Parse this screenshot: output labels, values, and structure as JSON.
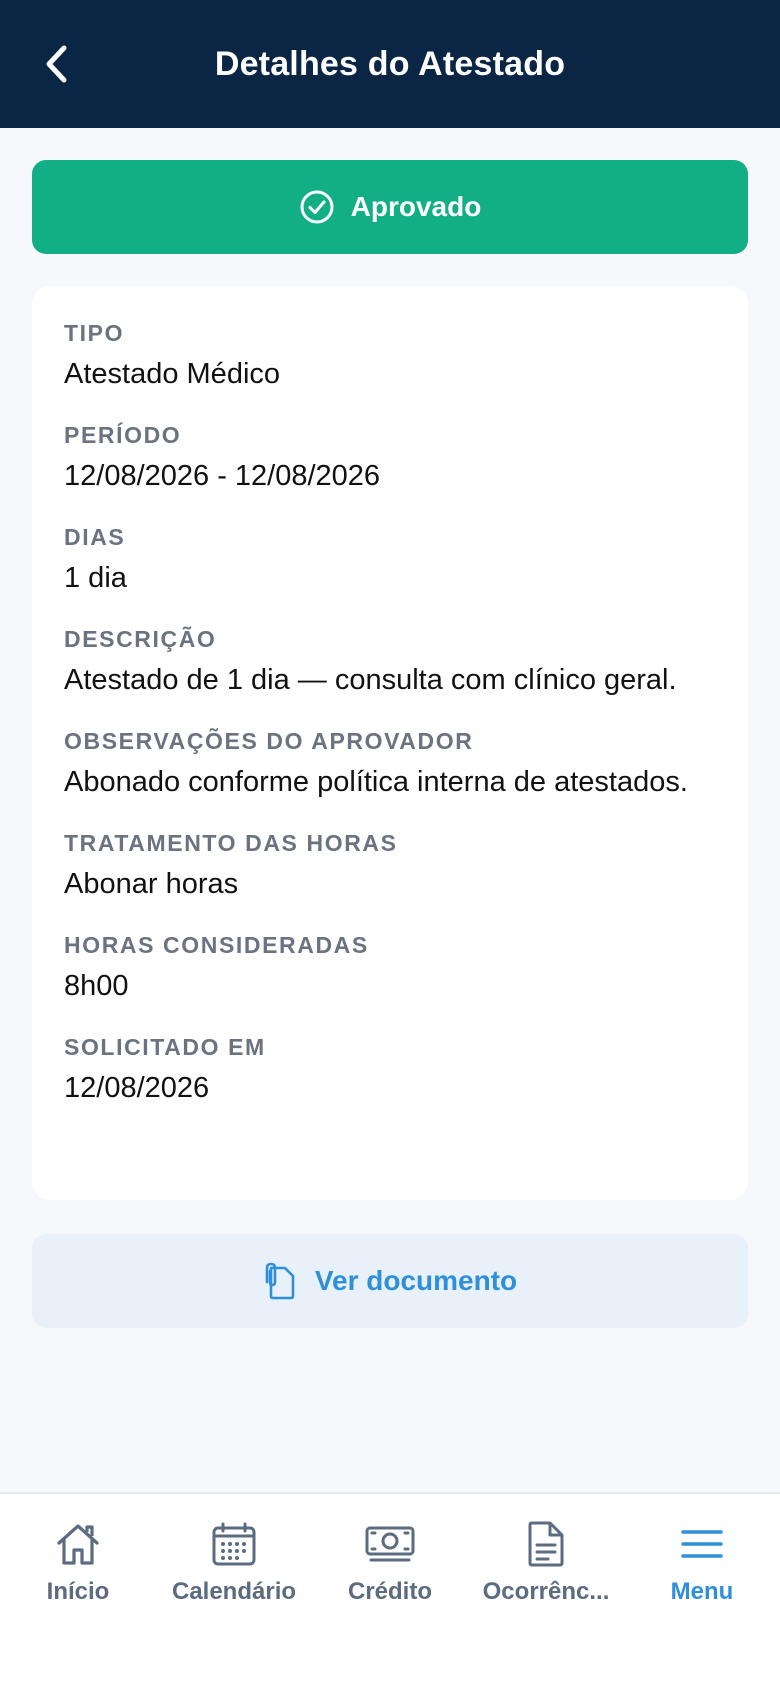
{
  "header": {
    "title": "Detalhes do Atestado",
    "back_icon": "chevron-left-icon"
  },
  "status": {
    "label": "Aprovado",
    "icon": "check-circle-icon",
    "color": "#12ae86"
  },
  "details": {
    "fields": [
      {
        "label": "TIPO",
        "value": "Atestado Médico"
      },
      {
        "label": "PERÍODO",
        "value": "12/08/2026 - 12/08/2026"
      },
      {
        "label": "DIAS",
        "value": "1 dia"
      },
      {
        "label": "DESCRIÇÃO",
        "value": "Atestado de 1 dia — consulta com clínico geral."
      },
      {
        "label": "OBSERVAÇÕES DO APROVADOR",
        "value": "Abonado conforme política interna de atestados."
      },
      {
        "label": "TRATAMENTO DAS HORAS",
        "value": "Abonar horas"
      },
      {
        "label": "HORAS CONSIDERADAS",
        "value": "8h00"
      },
      {
        "label": "SOLICITADO EM",
        "value": "12/08/2026"
      }
    ]
  },
  "document_button": {
    "label": "Ver documento",
    "icon": "paperclip-document-icon"
  },
  "tabbar": {
    "items": [
      {
        "label": "Início",
        "icon": "home-icon"
      },
      {
        "label": "Calendário",
        "icon": "calendar-icon"
      },
      {
        "label": "Crédito",
        "icon": "money-icon"
      },
      {
        "label": "Ocorrênc...",
        "icon": "document-icon"
      },
      {
        "label": "Menu",
        "icon": "menu-icon",
        "active": true
      }
    ],
    "active_color": "#2f8fd8",
    "inactive_color": "#5b6b80"
  }
}
